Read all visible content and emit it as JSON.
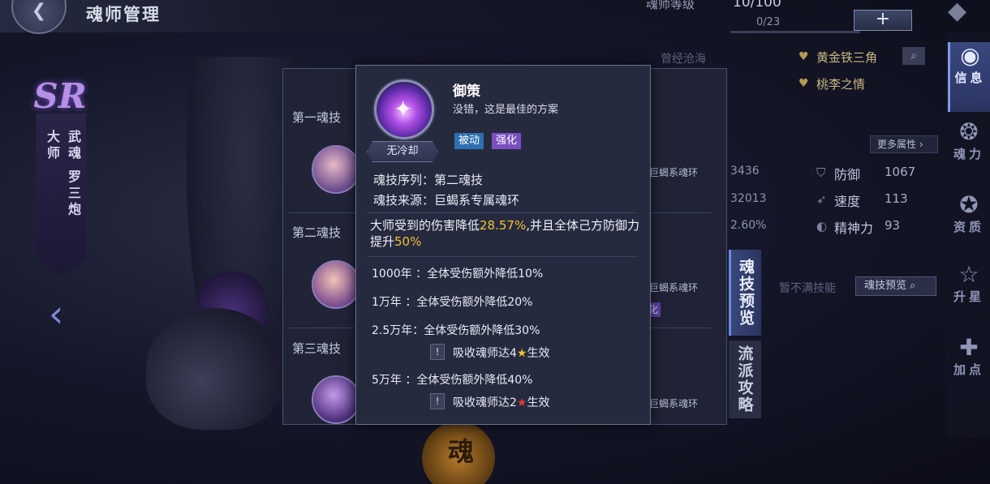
{
  "header": {
    "title": "魂师管理",
    "level_label": "魂师等级",
    "level_value": "10/100",
    "level_sub": "0/23",
    "add_label": "+"
  },
  "left": {
    "rarity": "SR",
    "rank_line1": "大师",
    "rank_line2": "武魂 罗三炮",
    "back_arrow": "‹"
  },
  "skill_list": {
    "skills": [
      {
        "heading": "第一魂技",
        "ring_source": "巨蝎系魂环"
      },
      {
        "heading": "第二魂技",
        "ring_source": "巨蝎系魂环",
        "tag": "化"
      },
      {
        "heading": "第三魂技",
        "ring_source": "巨蝎系魂环"
      }
    ],
    "preview_button": "魂技预览",
    "school_button": "流派攻略"
  },
  "info": {
    "past_text": "曾经沧海",
    "affinity": [
      "黄金铁三角",
      "桃李之情"
    ],
    "more_attributes": "更多属性 ›",
    "fragments": [
      "3436",
      "32013",
      "2.60%"
    ],
    "stats": [
      {
        "label": "防御",
        "value": "1067"
      },
      {
        "label": "速度",
        "value": "113"
      },
      {
        "label": "精神力",
        "value": "93"
      }
    ],
    "no_skill_text": "暂不满技能",
    "preview_search": "魂技预览"
  },
  "sidebar": {
    "items": [
      {
        "label": "信息",
        "icon": "eye-icon"
      },
      {
        "label": "魂力",
        "icon": "flame-icon"
      },
      {
        "label": "资质",
        "icon": "crest-icon"
      },
      {
        "label": "升星",
        "icon": "star-icon"
      },
      {
        "label": "加点",
        "icon": "cross-icon"
      }
    ]
  },
  "soul_badge": "魂",
  "tooltip": {
    "name": "御策",
    "description": "没错，这是最佳的方案",
    "cooldown": "无冷却",
    "tags": [
      "被动",
      "强化"
    ],
    "sequence": "魂技序列：第二魂技",
    "source": "魂技来源：巨蝎系专属魂环",
    "effect_pre": "大师受到的伤害降低",
    "effect_hl1": "28.57%",
    "effect_mid": ",并且全体己方防御力提升",
    "effect_hl2": "50%",
    "year_effects": [
      "1000年 ：全体受伤额外降低10%",
      "1万年 ：全体受伤额外降低20%",
      "2.5万年：全体受伤额外降低30%",
      "5万年 ：全体受伤额外降低40%"
    ],
    "conditions": [
      {
        "pre": "吸收魂师达4",
        "star": "★",
        "post": "生效"
      },
      {
        "pre": "吸收魂师达2",
        "star": "★",
        "post": "生效"
      }
    ],
    "warn_glyph": "!"
  },
  "colors": {
    "highlight": "#f1c232",
    "tag_passive": "#2e6fb0",
    "tag_enhance": "#7a4fc0",
    "star_gold": "#f2c22a",
    "star_red": "#e23b3b"
  }
}
